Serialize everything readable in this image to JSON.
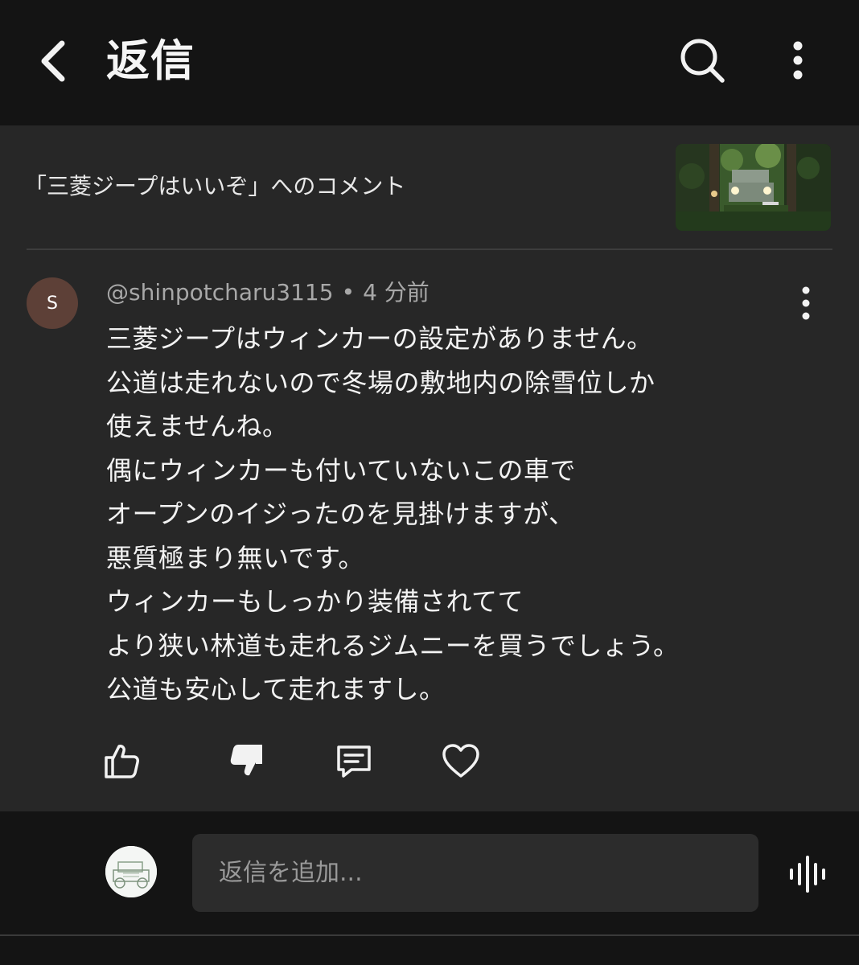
{
  "header": {
    "title": "返信",
    "back_icon": "chevron-left-icon",
    "search_icon": "search-icon",
    "more_icon": "more-vertical-icon"
  },
  "context": {
    "text": "「三菱ジープはいいぞ」へのコメント",
    "thumbnail": "video-thumbnail"
  },
  "comment": {
    "avatar_initial": "S",
    "avatar_color": "#5d4037",
    "author": "@shinpotcharu3115",
    "separator": "•",
    "time": "4 分前",
    "lines": [
      "三菱ジープはウィンカーの設定がありません。",
      "公道は走れないので冬場の敷地内の除雪位しか",
      "使えませんね。",
      "偶にウィンカーも付いていないこの車で",
      "オープンのイジったのを見掛けますが、",
      "悪質極まり無いです。",
      "ウィンカーもしっかり装備されてて",
      "より狭い林道も走れるジムニーを買うでしょう。",
      "公道も安心して走れますし。"
    ],
    "actions": [
      "like-icon",
      "dislike-icon",
      "reply-icon",
      "heart-icon"
    ]
  },
  "reply_bar": {
    "placeholder": "返信を追加...",
    "voice_icon": "voice-search-icon"
  }
}
